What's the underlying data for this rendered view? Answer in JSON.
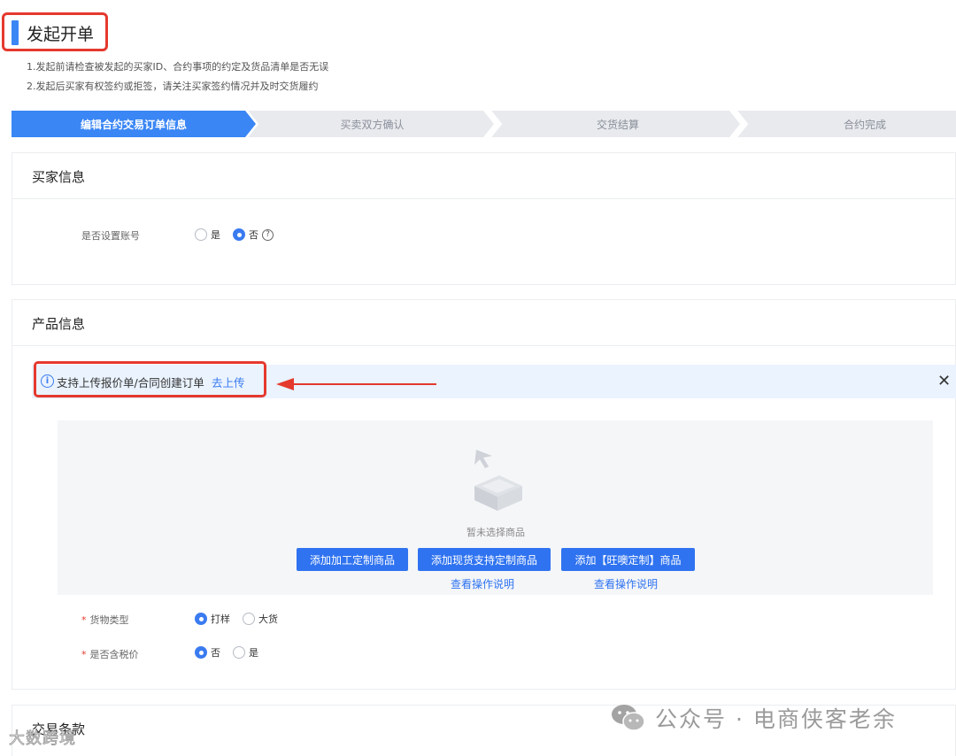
{
  "header": {
    "title": "发起开单",
    "notes": [
      "1.发起前请检查被发起的买家ID、合约事项的约定及货品清单是否无误",
      "2.发起后买家有权签约或拒签，请关注买家签约情况并及时交货履约"
    ]
  },
  "steps": [
    {
      "label": "编辑合约交易订单信息",
      "active": true
    },
    {
      "label": "买卖双方确认",
      "active": false
    },
    {
      "label": "交货结算",
      "active": false
    },
    {
      "label": "合约完成",
      "active": false
    }
  ],
  "buyer_section": {
    "title": "买家信息",
    "account_label": "是否设置账号",
    "options": [
      "是",
      "否"
    ],
    "selected": "否",
    "help_icon": "question-circle-icon"
  },
  "product_section": {
    "title": "产品信息",
    "banner": {
      "icon": "info-circle-icon",
      "text": "支持上传报价单/合同创建订单",
      "link": "去上传",
      "close_icon": "close-icon"
    },
    "empty_text": "暂未选择商品",
    "buttons": [
      "添加加工定制商品",
      "添加现货支持定制商品",
      "添加【旺噢定制】商品"
    ],
    "help_links": [
      "查看操作说明",
      "查看操作说明"
    ],
    "goods_type": {
      "label": "货物类型",
      "options": [
        "打样",
        "大货"
      ],
      "selected": "打样"
    },
    "tax": {
      "label": "是否含税价",
      "options": [
        "否",
        "是"
      ],
      "selected": "否"
    }
  },
  "terms_section": {
    "title": "交易条款"
  },
  "watermarks": {
    "right": "公众号 · 电商侠客老余",
    "left": "大数跨境"
  },
  "colors": {
    "accent": "#3a7bf0",
    "highlight_border": "#e5392e",
    "step_active": "#3a86f5",
    "step_inactive": "#e8eaee",
    "banner_bg": "#eaf3fe"
  }
}
